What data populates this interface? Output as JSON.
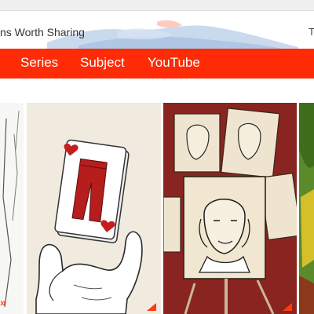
{
  "header": {
    "tagline": "ns Worth Sharing",
    "corner_text": "T"
  },
  "nav": {
    "items": [
      {
        "label": "Series"
      },
      {
        "label": "Subject"
      },
      {
        "label": "YouTube"
      }
    ]
  },
  "gallery": {
    "prev_arrows": "»",
    "cards": [
      {
        "subject": "partial-sketch"
      },
      {
        "subject": "hand-holding-playing-cards"
      },
      {
        "subject": "shakespeare-portrait-puppets"
      },
      {
        "subject": "green-cartoon-partial"
      }
    ]
  },
  "colors": {
    "brand_red": "#ff2b06",
    "nav_text": "#ffffff",
    "page_bg": "#ffffff"
  }
}
